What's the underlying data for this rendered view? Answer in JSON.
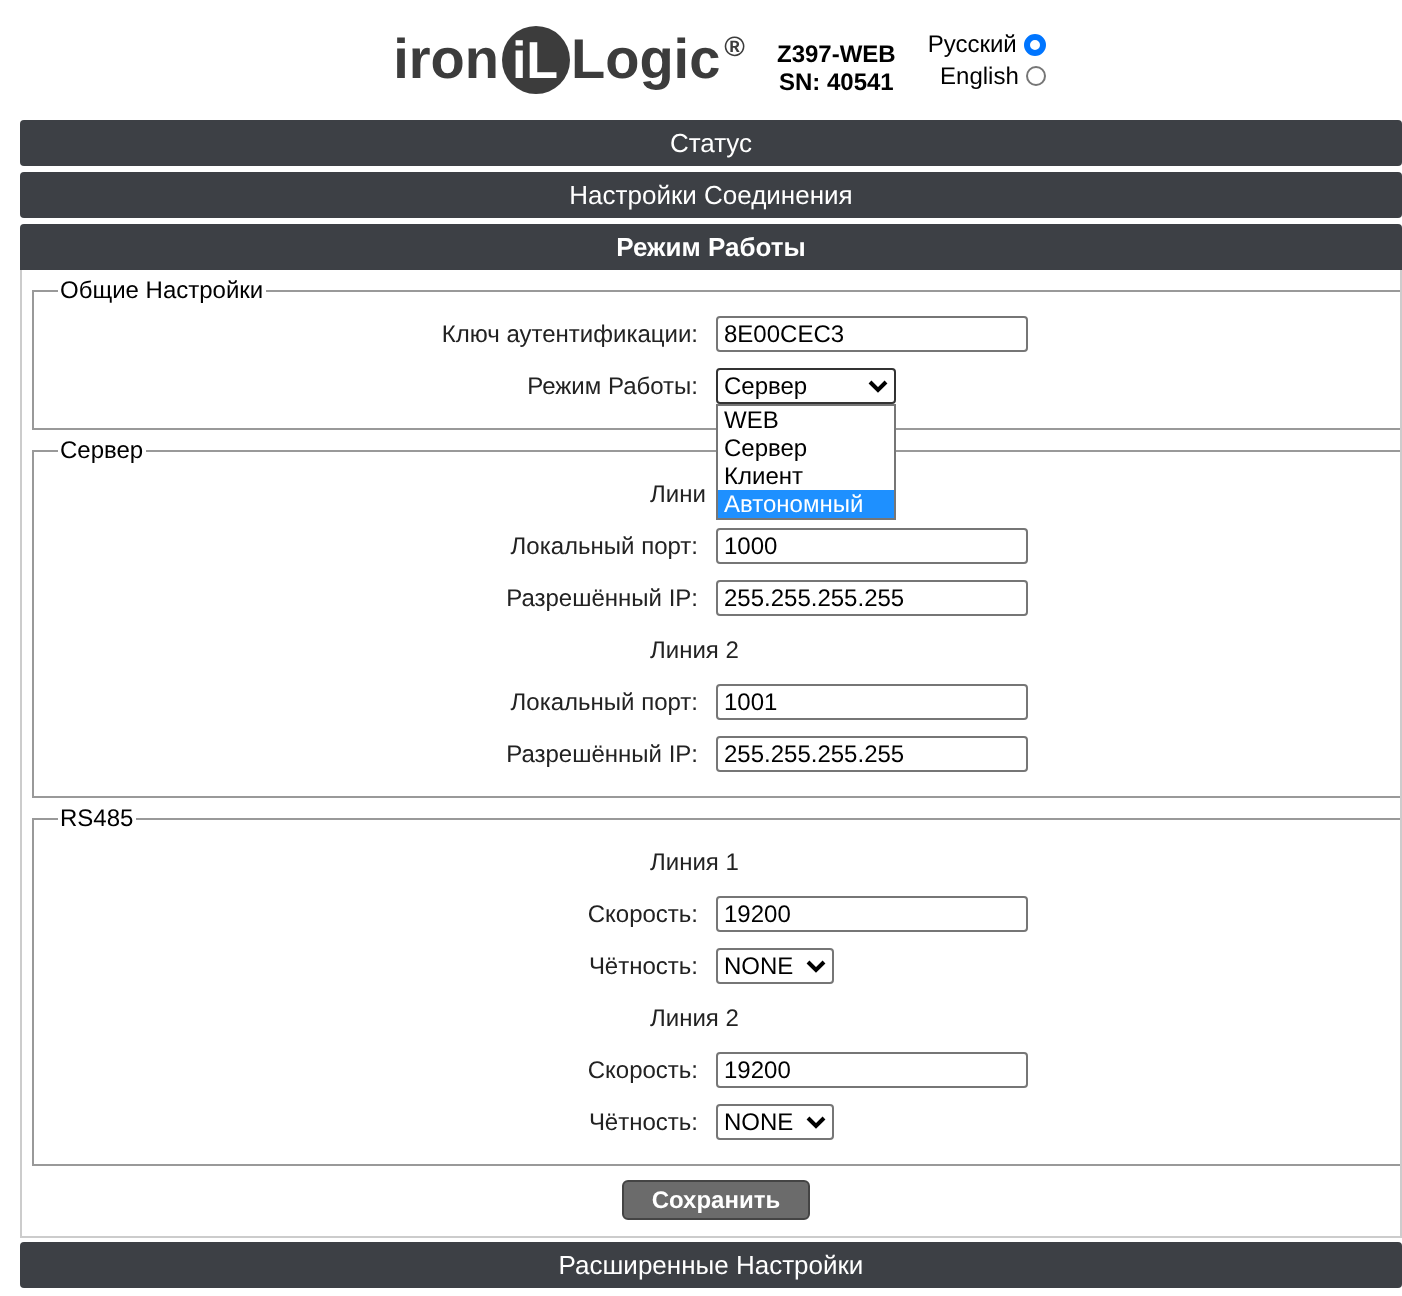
{
  "header": {
    "logo": {
      "left": "iron",
      "mark": "iL",
      "right": "Logic",
      "reg": "®"
    },
    "model": "Z397-WEB",
    "serial": "SN: 40541",
    "languages": [
      {
        "label": "Русский",
        "selected": true
      },
      {
        "label": "English",
        "selected": false
      }
    ]
  },
  "sections_top": [
    {
      "label": "Статус",
      "selected": false
    },
    {
      "label": "Настройки Соединения",
      "selected": false
    },
    {
      "label": "Режим Работы",
      "selected": true
    }
  ],
  "groups": [
    {
      "legend": "Общие Настройки",
      "rows": [
        {
          "kind": "input",
          "label": "Ключ аутентификации:",
          "value": "8E00CEC3"
        },
        {
          "kind": "select",
          "label": "Режим Работы:",
          "value": "Сервер",
          "open": true,
          "options": [
            {
              "label": "WEB",
              "highlighted": false
            },
            {
              "label": "Сервер",
              "highlighted": false
            },
            {
              "label": "Клиент",
              "highlighted": false
            },
            {
              "label": "Автономный",
              "highlighted": true
            }
          ]
        }
      ]
    },
    {
      "legend": "Сервер",
      "rows": [
        {
          "kind": "heading",
          "label": "Лини"
        },
        {
          "kind": "input",
          "label": "Локальный порт:",
          "value": "1000"
        },
        {
          "kind": "input",
          "label": "Разрешённый IP:",
          "value": "255.255.255.255"
        },
        {
          "kind": "heading",
          "label": "Линия 2"
        },
        {
          "kind": "input",
          "label": "Локальный порт:",
          "value": "1001"
        },
        {
          "kind": "input",
          "label": "Разрешённый IP:",
          "value": "255.255.255.255"
        }
      ]
    },
    {
      "legend": "RS485",
      "rows": [
        {
          "kind": "heading",
          "label": "Линия 1"
        },
        {
          "kind": "input",
          "label": "Скорость:",
          "value": "19200"
        },
        {
          "kind": "select",
          "label": "Чётность:",
          "value": "NONE",
          "open": false
        },
        {
          "kind": "heading",
          "label": "Линия 2"
        },
        {
          "kind": "input",
          "label": "Скорость:",
          "value": "19200"
        },
        {
          "kind": "select",
          "label": "Чётность:",
          "value": "NONE",
          "open": false
        }
      ]
    }
  ],
  "save_button": "Сохранить",
  "sections_bottom": [
    {
      "label": "Расширенные Настройки",
      "selected": false
    }
  ]
}
